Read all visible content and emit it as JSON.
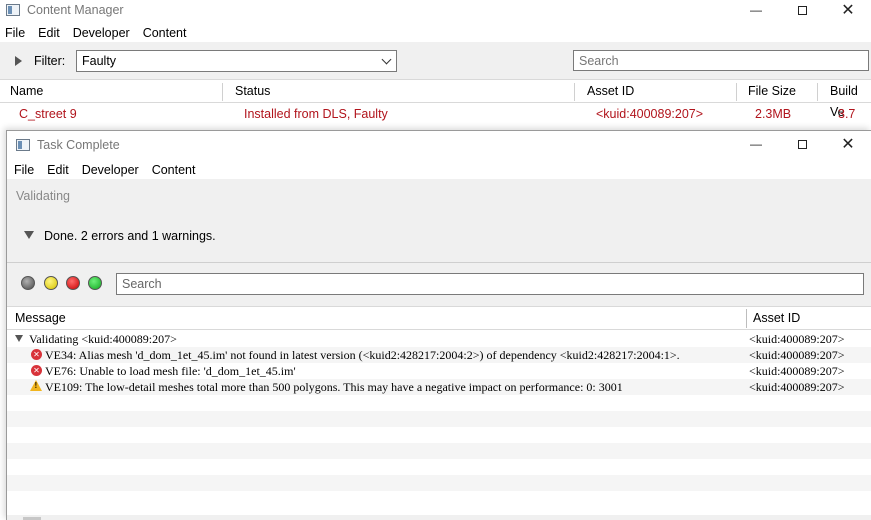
{
  "content_manager": {
    "title": "Content Manager",
    "menu": [
      "File",
      "Edit",
      "Developer",
      "Content"
    ],
    "filter": {
      "label": "Filter:",
      "value": "Faulty"
    },
    "search": {
      "placeholder": "Search"
    },
    "columns": [
      "Name",
      "Status",
      "Asset ID",
      "File Size",
      "Build Ve"
    ],
    "rows": [
      {
        "name": "C_street 9",
        "status": "Installed from DLS, Faulty",
        "asset_id": "<kuid:400089:207>",
        "file_size": "2.3MB",
        "build": "3.7"
      }
    ]
  },
  "task_complete": {
    "title": "Task Complete",
    "menu": [
      "File",
      "Edit",
      "Developer",
      "Content"
    ],
    "stage_label": "Validating",
    "summary": "Done. 2 errors and 1 warnings.",
    "search": {
      "placeholder": "Search"
    },
    "columns": {
      "message": "Message",
      "asset_id": "Asset ID"
    },
    "log": [
      {
        "type": "group",
        "message": "Validating <kuid:400089:207>",
        "asset_id": "<kuid:400089:207>"
      },
      {
        "type": "error",
        "message": "VE34: Alias mesh 'd_dom_1et_45.im' not found in latest version (<kuid2:428217:2004:2>) of dependency <kuid2:428217:2004:1>.",
        "asset_id": "<kuid:400089:207>"
      },
      {
        "type": "error",
        "message": "VE76: Unable to load mesh file: 'd_dom_1et_45.im'",
        "asset_id": "<kuid:400089:207>"
      },
      {
        "type": "warning",
        "message": "VE109: The low-detail meshes total more than 500 polygons. This may have a negative impact on performance: 0: 3001",
        "asset_id": "<kuid:400089:207>"
      }
    ]
  },
  "colors": {
    "faulty_text": "#b1141c",
    "error_icon": "#d8333a",
    "warning_icon": "#f1b51f",
    "panel_bg": "#f0f0f0"
  },
  "icons": [
    "app-window-icon",
    "minimize-icon",
    "maximize-icon",
    "close-icon",
    "expand-triangle-icon",
    "chevron-down-icon",
    "collapse-triangle-icon",
    "error-icon",
    "warning-icon"
  ]
}
